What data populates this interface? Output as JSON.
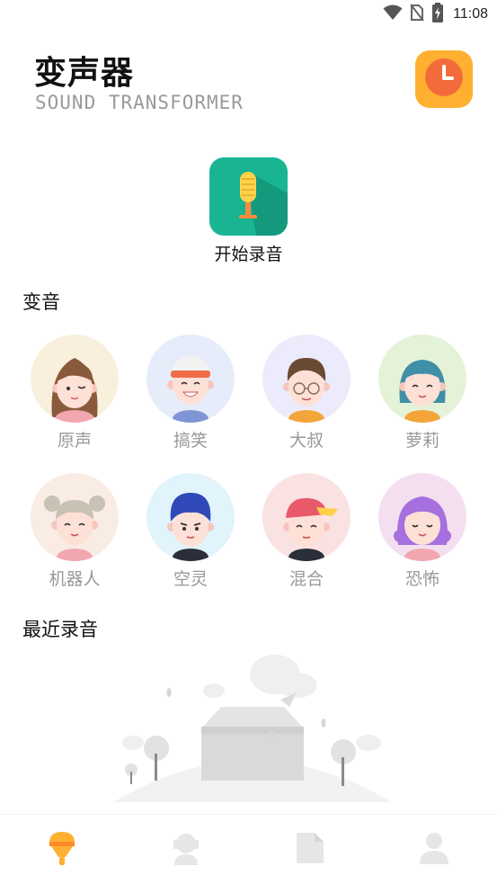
{
  "status_bar": {
    "time": "11:08",
    "icons": [
      "wifi-icon",
      "no-sim-icon",
      "battery-charging-icon"
    ]
  },
  "header": {
    "title": "变声器",
    "subtitle": "SOUND TRANSFORMER",
    "history_icon": "clock-icon"
  },
  "record": {
    "label": "开始录音",
    "icon": "microphone-icon"
  },
  "voice_section": {
    "title": "变音",
    "voices": [
      {
        "label": "原声",
        "avatar": "girl-brown-hair-avatar",
        "bg": "#f8f0dc"
      },
      {
        "label": "搞笑",
        "avatar": "boy-cap-avatar",
        "bg": "#e6ecf9"
      },
      {
        "label": "大叔",
        "avatar": "uncle-glasses-avatar",
        "bg": "#ecebfb"
      },
      {
        "label": "萝莉",
        "avatar": "loli-teal-hair-avatar",
        "bg": "#e4f2d8"
      },
      {
        "label": "机器人",
        "avatar": "robot-buns-avatar",
        "bg": "#f8ece4"
      },
      {
        "label": "空灵",
        "avatar": "boy-blue-hair-avatar",
        "bg": "#e1f3fb"
      },
      {
        "label": "混合",
        "avatar": "mixed-red-cap-avatar",
        "bg": "#fbe2e2"
      },
      {
        "label": "恐怖",
        "avatar": "purple-hair-avatar",
        "bg": "#f4dff0"
      }
    ]
  },
  "recent_section": {
    "title": "最近录音",
    "illustration": "empty-box-illustration"
  },
  "bottom_nav": {
    "tabs": [
      {
        "icon": "microphone-tab-icon",
        "active": true
      },
      {
        "icon": "voice-person-tab-icon",
        "active": false
      },
      {
        "icon": "document-tab-icon",
        "active": false
      },
      {
        "icon": "profile-tab-icon",
        "active": false
      }
    ]
  },
  "colors": {
    "accent": "#ffb031",
    "record_bg": "#19b593",
    "label_gray": "#999999",
    "nav_inactive": "#e6e6e6"
  }
}
